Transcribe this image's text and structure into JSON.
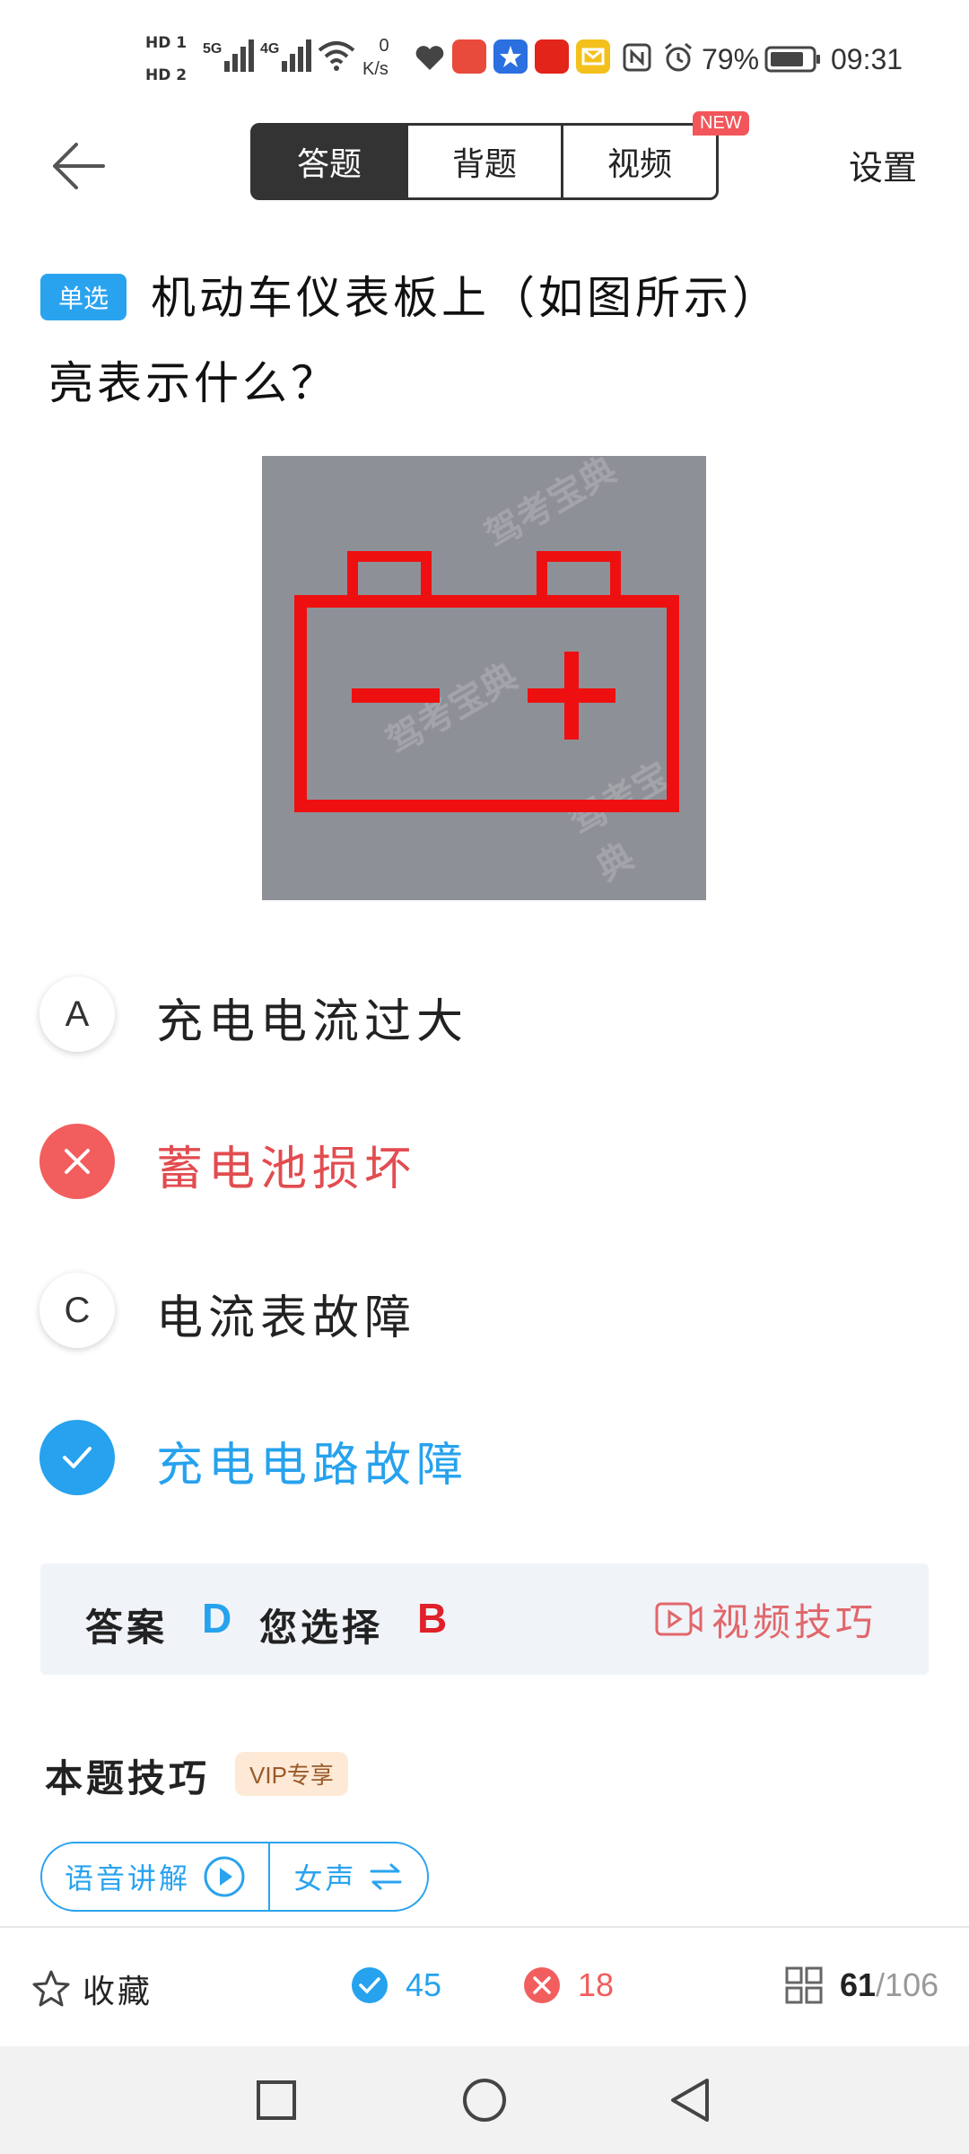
{
  "status_bar": {
    "net_speed_value": "0",
    "net_speed_unit": "K/s",
    "battery": "79%",
    "time": "09:31",
    "sim1": "HD 1",
    "sim2": "HD 2",
    "net1": "5G",
    "net2": "4G"
  },
  "header": {
    "tabs": [
      "答题",
      "背题",
      "视频"
    ],
    "new_badge": "NEW",
    "settings": "设置"
  },
  "question": {
    "type_tag": "单选",
    "text_line1": "机动车仪表板上（如图所示）",
    "text_line2": "亮表示什么？",
    "figure_watermark": "驾考宝典"
  },
  "options": [
    {
      "letter": "A",
      "text": "充电电流过大",
      "state": "normal"
    },
    {
      "letter": "B",
      "text": "蓄电池损坏",
      "state": "wrong"
    },
    {
      "letter": "C",
      "text": "电流表故障",
      "state": "normal"
    },
    {
      "letter": "D",
      "text": "充电电路故障",
      "state": "correct"
    }
  ],
  "answer": {
    "answer_label": "答案",
    "answer_value": "D",
    "selected_label": "您选择",
    "selected_value": "B",
    "video_tips": "视频技巧"
  },
  "tips": {
    "title": "本题技巧",
    "vip_badge": "VIP专享",
    "voice_explain": "语音讲解",
    "voice_gender": "女声"
  },
  "bottom_bar": {
    "favorite": "收藏",
    "correct_count": "45",
    "wrong_count": "18",
    "progress_current": "61",
    "progress_total": "/106"
  },
  "colors": {
    "accent_blue": "#26a2ee",
    "wrong_red": "#f25d5d",
    "answer_red": "#e0202a",
    "tips_red": "#e0676b"
  }
}
